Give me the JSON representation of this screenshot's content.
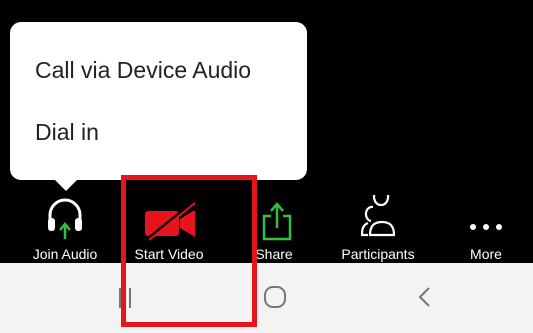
{
  "audio_menu": {
    "items": [
      "Call via Device Audio",
      "Dial in"
    ]
  },
  "toolbar": {
    "join_audio": {
      "label": "Join Audio",
      "icon": "headphones-arrow-icon"
    },
    "start_video": {
      "label": "Start Video",
      "icon": "video-off-icon"
    },
    "share": {
      "label": "Share",
      "icon": "share-arrow-icon"
    },
    "participants": {
      "label": "Participants",
      "icon": "participants-icon"
    },
    "more": {
      "label": "More",
      "icon": "more-dots-icon"
    }
  },
  "navigation": {
    "buttons": [
      "recent-apps-icon",
      "home-icon",
      "back-icon"
    ]
  },
  "colors": {
    "toolbar_background": "#000000",
    "video_off_red": "#e8141b",
    "share_green": "#2fbf49",
    "highlight_red": "#e8141b",
    "nav_background": "#f3f3f3"
  }
}
